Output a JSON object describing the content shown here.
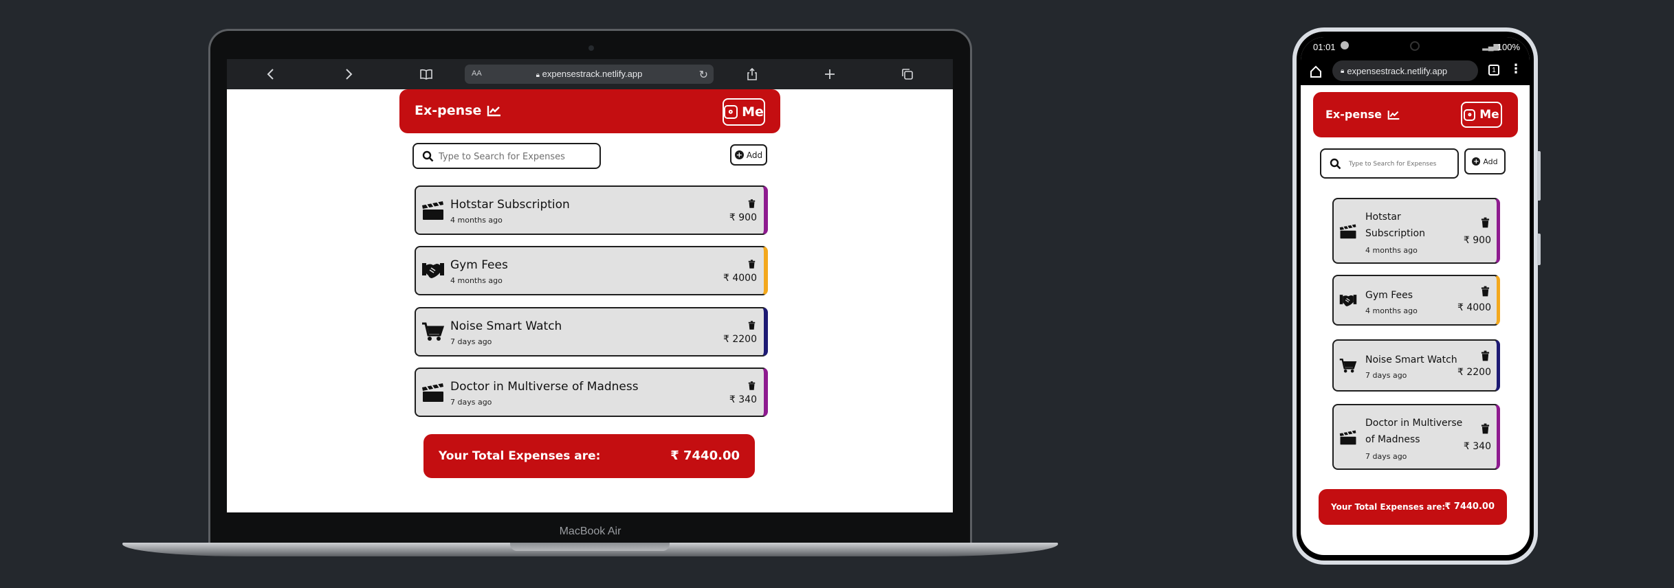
{
  "browser": {
    "url": "expensestrack.netlify.app",
    "reader_label": "AA",
    "tabs_count": "1"
  },
  "laptop": {
    "brand_label": "MacBook Air"
  },
  "phone_status": {
    "time": "01:01",
    "battery": "100%"
  },
  "app": {
    "brand": "Ex-pense",
    "me_label": "Me",
    "search_placeholder": "Type to Search for Expenses",
    "add_label": "Add",
    "currency": "₹",
    "total_label": "Your Total Expenses are:",
    "total_value": "₹ 7440.00",
    "expenses": [
      {
        "title": "Hotstar Subscription",
        "time": "4 months ago",
        "amount": "₹ 900",
        "icon": "clapperboard-icon",
        "accent": "#8e1b8f"
      },
      {
        "title": "Gym Fees",
        "time": "4 months ago",
        "amount": "₹ 4000",
        "icon": "handshake-icon",
        "accent": "#f3a81d"
      },
      {
        "title": "Noise Smart Watch",
        "time": "7 days ago",
        "amount": "₹ 2200",
        "icon": "shopping-cart-icon",
        "accent": "#1d1a73"
      },
      {
        "title": "Doctor in Multiverse of Madness",
        "time": "7 days ago",
        "amount": "₹ 340",
        "icon": "clapperboard-icon",
        "accent": "#8e1b8f"
      }
    ]
  },
  "colors": {
    "brand_red": "#c40e11",
    "card_bg": "#e1e1e1",
    "page_bg": "#24282d"
  }
}
